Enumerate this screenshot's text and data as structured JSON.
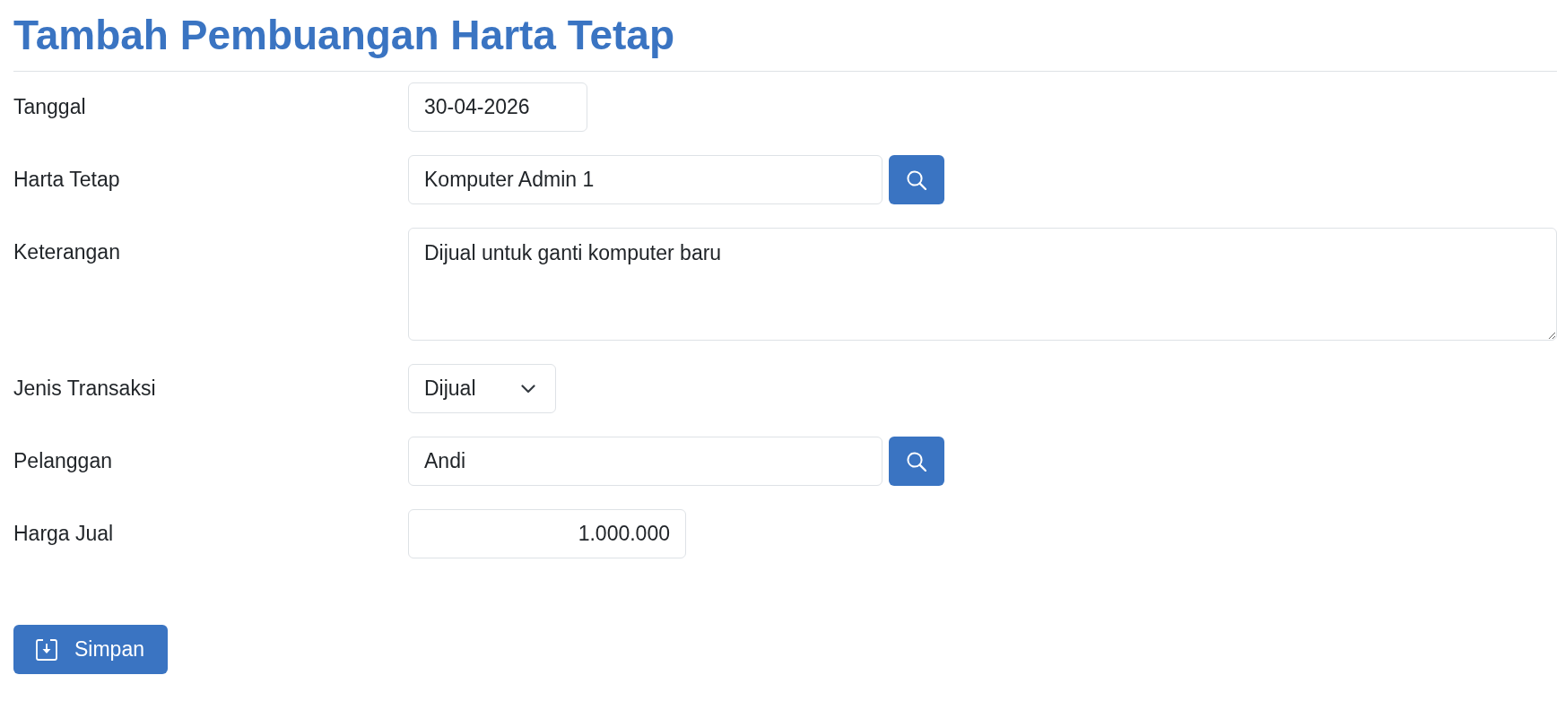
{
  "page": {
    "title": "Tambah Pembuangan Harta Tetap"
  },
  "fields": [
    {
      "kind": "date",
      "label": "Tanggal",
      "value": "30-04-2026"
    },
    {
      "kind": "lookup",
      "label": "Harta Tetap",
      "value": "Komputer Admin 1"
    },
    {
      "kind": "textarea",
      "label": "Keterangan",
      "value": "Dijual untuk ganti komputer baru"
    },
    {
      "kind": "select",
      "label": "Jenis Transaksi",
      "value": "Dijual"
    },
    {
      "kind": "lookup",
      "label": "Pelanggan",
      "value": "Andi"
    },
    {
      "kind": "number",
      "label": "Harga Jual",
      "value": "1.000.000"
    }
  ],
  "buttons": [
    {
      "kind": "save",
      "label": "Simpan"
    }
  ]
}
